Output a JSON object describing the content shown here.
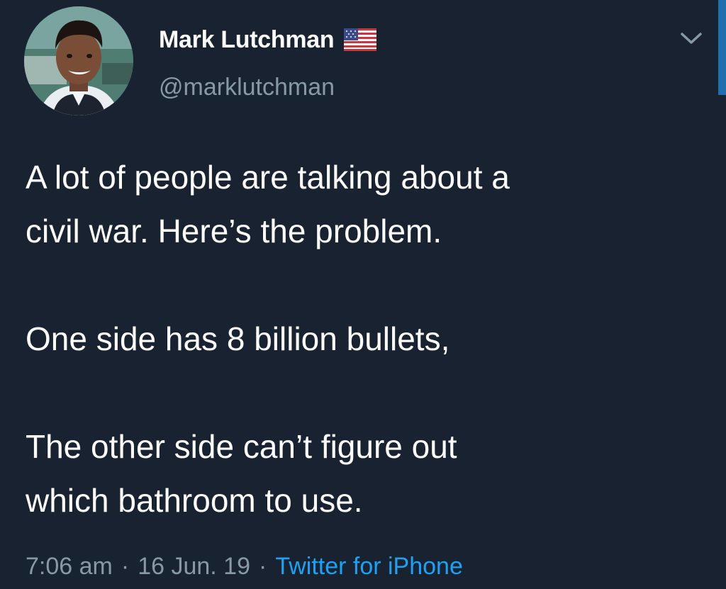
{
  "tweet": {
    "author": {
      "display_name": "Mark Lutchman",
      "handle": "@marklutchman",
      "flag_icon": "us-flag-icon"
    },
    "text_lines": [
      "A lot of people are talking about a",
      "civil war. Here’s the problem.",
      "One side has 8 billion bullets,",
      "The other side can’t figure out",
      "which bathroom to use."
    ],
    "meta": {
      "time": "7:06 am",
      "date": "16 Jun. 19",
      "separator": "·",
      "source": "Twitter for iPhone"
    }
  },
  "colors": {
    "background": "#192230",
    "primary_text": "#ffffff",
    "secondary_text": "#8899a6",
    "link": "#1da1f2"
  },
  "icons": {
    "menu": "chevron-down-icon",
    "avatar": "profile-photo"
  }
}
